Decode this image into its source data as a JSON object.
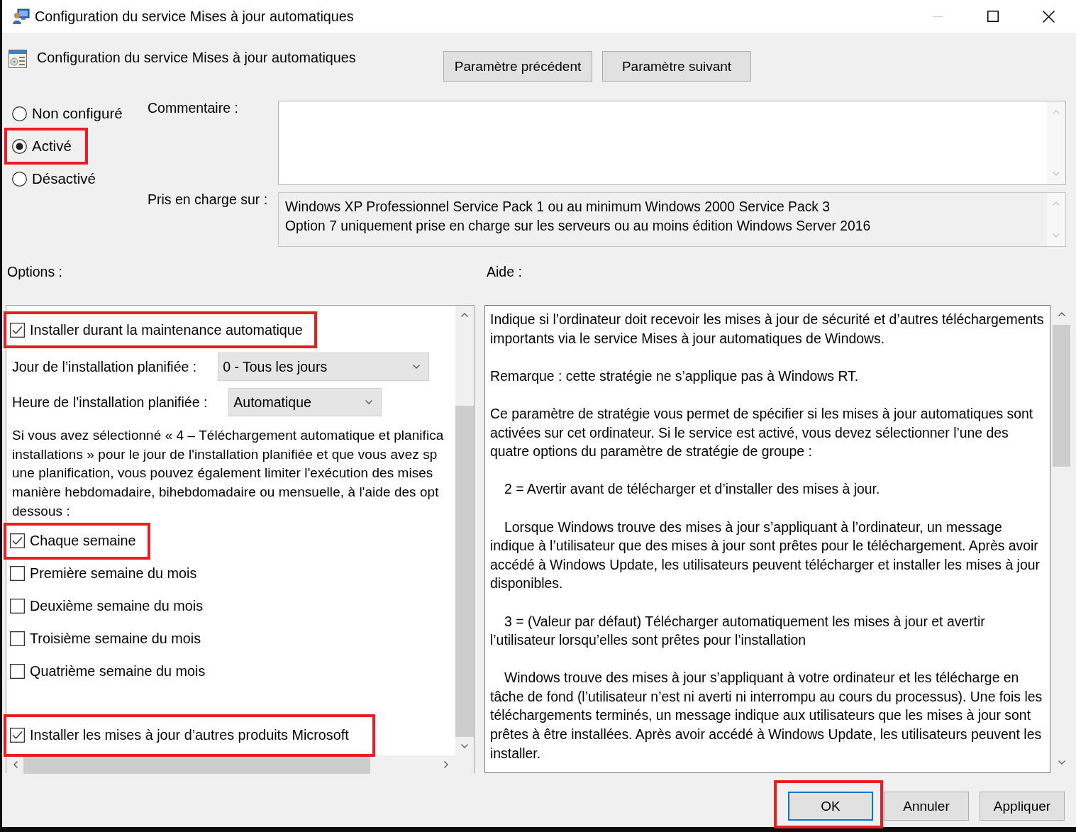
{
  "window": {
    "title": "Configuration du service Mises à jour automatiques",
    "minimize_disabled": true
  },
  "header": {
    "title": "Configuration du service Mises à jour automatiques",
    "buttons": [
      {
        "label": "Paramètre précédent"
      },
      {
        "label": "Paramètre suivant"
      }
    ]
  },
  "state_options": [
    {
      "label": "Non configuré",
      "selected": false,
      "highlighted": false
    },
    {
      "label": "Activé",
      "selected": true,
      "highlighted": true
    },
    {
      "label": "Désactivé",
      "selected": false,
      "highlighted": false
    }
  ],
  "comment": {
    "label": "Commentaire :"
  },
  "supported_on": {
    "label": "Pris en charge sur :",
    "lines": [
      "Windows XP Professionnel Service Pack 1 ou au minimum Windows 2000 Service Pack 3",
      "Option 7 uniquement prise en charge sur les serveurs ou au moins édition Windows Server 2016"
    ]
  },
  "options": {
    "label": "Options :",
    "items": [
      {
        "kind": "checkbox",
        "label": "Installer durant la maintenance automatique",
        "checked": true,
        "highlighted": true
      },
      {
        "kind": "dropdown",
        "label": "Jour de l’installation planifiée :",
        "value": "0 - Tous les jours"
      },
      {
        "kind": "dropdown",
        "label": "Heure de l’installation planifiée :",
        "value": "Automatique"
      },
      {
        "kind": "text",
        "lines": [
          "Si vous avez sélectionné « 4 – Téléchargement automatique et planifica",
          "installations » pour le jour de l'installation planifiée et que vous avez sp",
          "une planification, vous pouvez également limiter l'exécution des mises",
          "manière hebdomadaire, bihebdomadaire ou mensuelle, à l'aide des opt",
          "dessous :"
        ]
      },
      {
        "kind": "checkbox",
        "label": "Chaque semaine",
        "checked": true,
        "highlighted": true
      },
      {
        "kind": "checkbox",
        "label": "Première semaine du mois",
        "checked": false,
        "highlighted": false
      },
      {
        "kind": "checkbox",
        "label": "Deuxième semaine du mois",
        "checked": false,
        "highlighted": false
      },
      {
        "kind": "checkbox",
        "label": "Troisième semaine du mois",
        "checked": false,
        "highlighted": false
      },
      {
        "kind": "checkbox",
        "label": "Quatrième semaine du mois",
        "checked": false,
        "highlighted": false
      },
      {
        "kind": "checkbox",
        "label": "Installer les mises à jour d’autres produits Microsoft",
        "checked": true,
        "highlighted": true
      }
    ]
  },
  "help": {
    "label": "Aide :",
    "paragraphs": [
      {
        "text": "Indique si l’ordinateur doit recevoir les mises à jour de sécurité et d’autres téléchargements importants via le service Mises à jour automatiques de Windows.",
        "indent": false
      },
      {
        "text": "Remarque : cette stratégie ne s’applique pas à Windows RT.",
        "indent": false
      },
      {
        "text": "Ce paramètre de stratégie vous permet de spécifier si les mises à jour automatiques sont activées sur cet ordinateur. Si le service est activé, vous devez sélectionner l’une des quatre options du paramètre de stratégie de groupe :",
        "indent": false
      },
      {
        "text": "2 = Avertir avant de télécharger et d’installer des mises à jour.",
        "indent": true
      },
      {
        "text": "Lorsque Windows trouve des mises à jour s’appliquant à l’ordinateur, un message indique à l’utilisateur que des mises à jour sont prêtes pour le téléchargement. Après avoir accédé à Windows Update, les utilisateurs peuvent télécharger et installer les mises à jour disponibles.",
        "indent": true
      },
      {
        "text": "3 = (Valeur par défaut) Télécharger automatiquement les mises à jour et avertir l’utilisateur lorsqu’elles sont prêtes pour l’installation",
        "indent": true
      },
      {
        "text": "Windows trouve des mises à jour s’appliquant à votre ordinateur et les télécharge en tâche de fond (l’utilisateur n’est ni averti ni interrompu au cours du processus). Une fois les téléchargements terminés, un message indique aux utilisateurs que les mises à jour sont prêtes à être installées. Après avoir accédé à Windows Update, les utilisateurs peuvent les installer.",
        "indent": true
      }
    ]
  },
  "buttons": [
    {
      "label": "OK",
      "default": true,
      "highlighted": true
    },
    {
      "label": "Annuler",
      "default": false,
      "highlighted": false
    },
    {
      "label": "Appliquer",
      "default": false,
      "highlighted": false
    }
  ]
}
